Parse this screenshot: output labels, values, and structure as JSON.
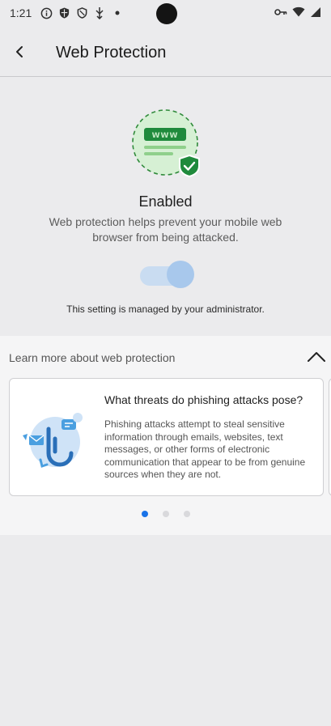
{
  "status_bar": {
    "time": "1:21",
    "left_icons": [
      "info-icon",
      "shield-icon",
      "shield-outline-icon",
      "usb-icon",
      "dot-icon"
    ],
    "right_icons": [
      "key-icon",
      "wifi-icon",
      "signal-icon"
    ]
  },
  "header": {
    "back_icon": "chevron-left-icon",
    "title": "Web Protection"
  },
  "hero": {
    "illustration_text": "WWW",
    "status": "Enabled",
    "description": "Web protection helps prevent your mobile web browser from being attacked.",
    "toggle_on": true,
    "admin_note": "This setting is managed by your administrator."
  },
  "learn_more": {
    "label": "Learn more about web protection",
    "expanded": true,
    "cards": [
      {
        "title": "What threats do phishing attacks pose?",
        "body": "Phishing attacks attempt to steal sensitive information through emails, websites, text messages, or other forms of electronic communication that appear to be from genuine sources when they are not."
      }
    ],
    "page_count": 3,
    "active_page": 1
  },
  "colors": {
    "accent": "#1a73e8",
    "shield_green": "#1f8a3c",
    "illustration_green_bg": "#d6f0d4",
    "toggle_track": "#c9dcf1",
    "toggle_thumb": "#a8c8ec"
  }
}
